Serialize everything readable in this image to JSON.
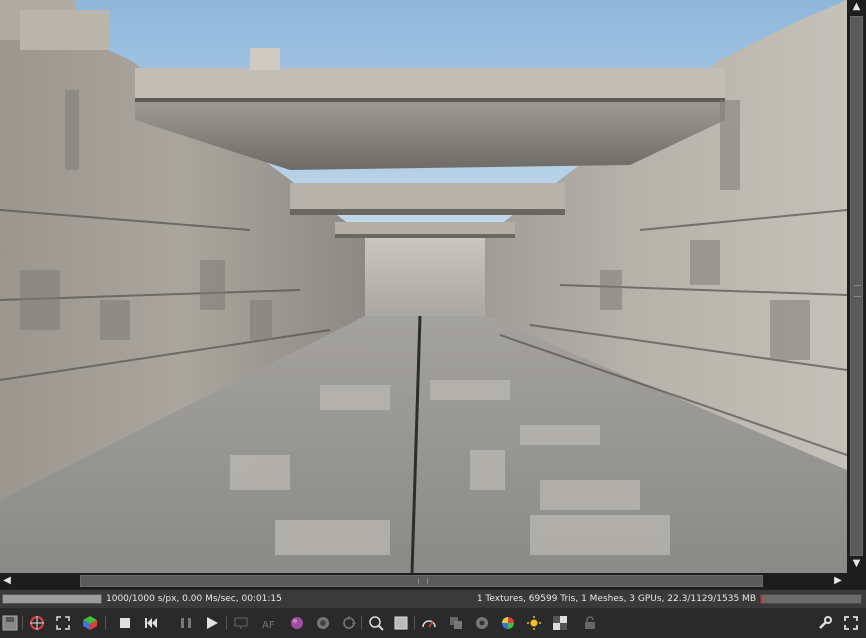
{
  "status": {
    "left_text": "1000/1000 s/px, 0.00 Ms/sec, 00:01:15",
    "right_text": "1 Textures, 69599 Tris, 1 Meshes, 3 GPUs, 22.3/1129/1535 MB",
    "render_progress": 1.0,
    "memory_usage_fraction": 0.02
  },
  "colors": {
    "sky": "#a9c9e3",
    "stone": "#bdbab2",
    "toolbar_bg": "#2a2a2a",
    "memory_bar": "#c43a3a"
  },
  "toolbar": {
    "left_icons": [
      "save-render-icon",
      "region-render-icon",
      "fit-view-icon",
      "color-cube-icon",
      "stop-icon",
      "restart-icon",
      "pause-icon",
      "play-icon",
      "viewport-icon",
      "autofocus-icon",
      "material-picker-icon",
      "object-picker-icon",
      "camera-target-icon",
      "zoom-region-icon",
      "clay-mode-icon",
      "gauge-icon",
      "layers-icon",
      "color-wheel-icon",
      "sun-icon",
      "checker-icon",
      "lock-icon"
    ],
    "right_icons": [
      "wrench-icon",
      "fullscreen-icon"
    ]
  }
}
